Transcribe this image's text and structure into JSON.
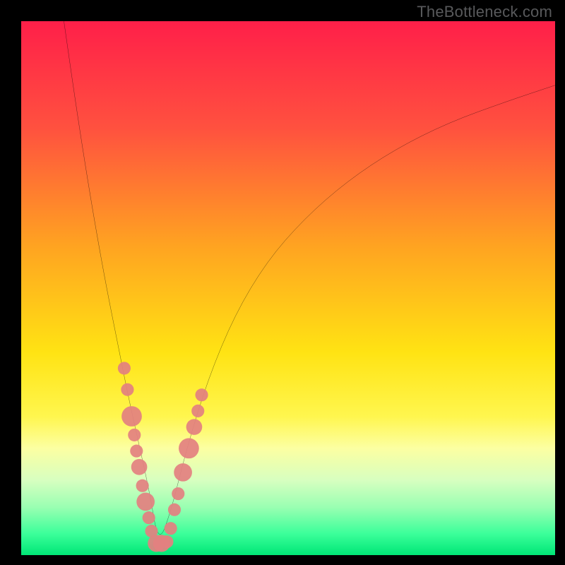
{
  "watermark": "TheBottleneck.com",
  "chart_data": {
    "type": "line",
    "title": "",
    "xlabel": "",
    "ylabel": "",
    "xlim": [
      0,
      100
    ],
    "ylim": [
      0,
      100
    ],
    "background_gradient_stops": [
      {
        "pct": 0,
        "color": "#ff1f49"
      },
      {
        "pct": 20,
        "color": "#ff513f"
      },
      {
        "pct": 42,
        "color": "#ffa321"
      },
      {
        "pct": 62,
        "color": "#ffe313"
      },
      {
        "pct": 74,
        "color": "#fff64e"
      },
      {
        "pct": 80,
        "color": "#fcffa2"
      },
      {
        "pct": 86,
        "color": "#d7ffc0"
      },
      {
        "pct": 91,
        "color": "#9affb2"
      },
      {
        "pct": 96,
        "color": "#3bff9a"
      },
      {
        "pct": 100,
        "color": "#00e676"
      }
    ],
    "series": [
      {
        "name": "bottleneck-curve",
        "x": [
          8,
          10,
          12,
          14,
          16,
          18,
          20,
          22,
          24,
          25.7,
          28,
          31,
          35,
          40,
          46,
          53,
          61,
          70,
          80,
          91,
          100
        ],
        "y": [
          100,
          86,
          73,
          61,
          50,
          40,
          30,
          21,
          12,
          2,
          8,
          20,
          33,
          45,
          55,
          63,
          70,
          76,
          81,
          85,
          88
        ]
      }
    ],
    "markers": [
      {
        "x": 19.3,
        "y": 35.0,
        "r": 1.2
      },
      {
        "x": 19.9,
        "y": 31.0,
        "r": 1.2
      },
      {
        "x": 20.7,
        "y": 26.0,
        "r": 1.9
      },
      {
        "x": 21.2,
        "y": 22.5,
        "r": 1.2
      },
      {
        "x": 21.6,
        "y": 19.5,
        "r": 1.2
      },
      {
        "x": 22.1,
        "y": 16.5,
        "r": 1.5
      },
      {
        "x": 22.7,
        "y": 13.0,
        "r": 1.2
      },
      {
        "x": 23.3,
        "y": 10.0,
        "r": 1.7
      },
      {
        "x": 23.9,
        "y": 7.0,
        "r": 1.2
      },
      {
        "x": 24.4,
        "y": 4.5,
        "r": 1.2
      },
      {
        "x": 25.3,
        "y": 2.2,
        "r": 1.6
      },
      {
        "x": 26.3,
        "y": 2.2,
        "r": 1.6
      },
      {
        "x": 27.3,
        "y": 2.5,
        "r": 1.2
      },
      {
        "x": 28.0,
        "y": 5.0,
        "r": 1.2
      },
      {
        "x": 28.7,
        "y": 8.5,
        "r": 1.2
      },
      {
        "x": 29.4,
        "y": 11.5,
        "r": 1.2
      },
      {
        "x": 30.3,
        "y": 15.5,
        "r": 1.7
      },
      {
        "x": 31.4,
        "y": 20.0,
        "r": 1.9
      },
      {
        "x": 32.4,
        "y": 24.0,
        "r": 1.5
      },
      {
        "x": 33.1,
        "y": 27.0,
        "r": 1.2
      },
      {
        "x": 33.8,
        "y": 30.0,
        "r": 1.2
      }
    ]
  }
}
